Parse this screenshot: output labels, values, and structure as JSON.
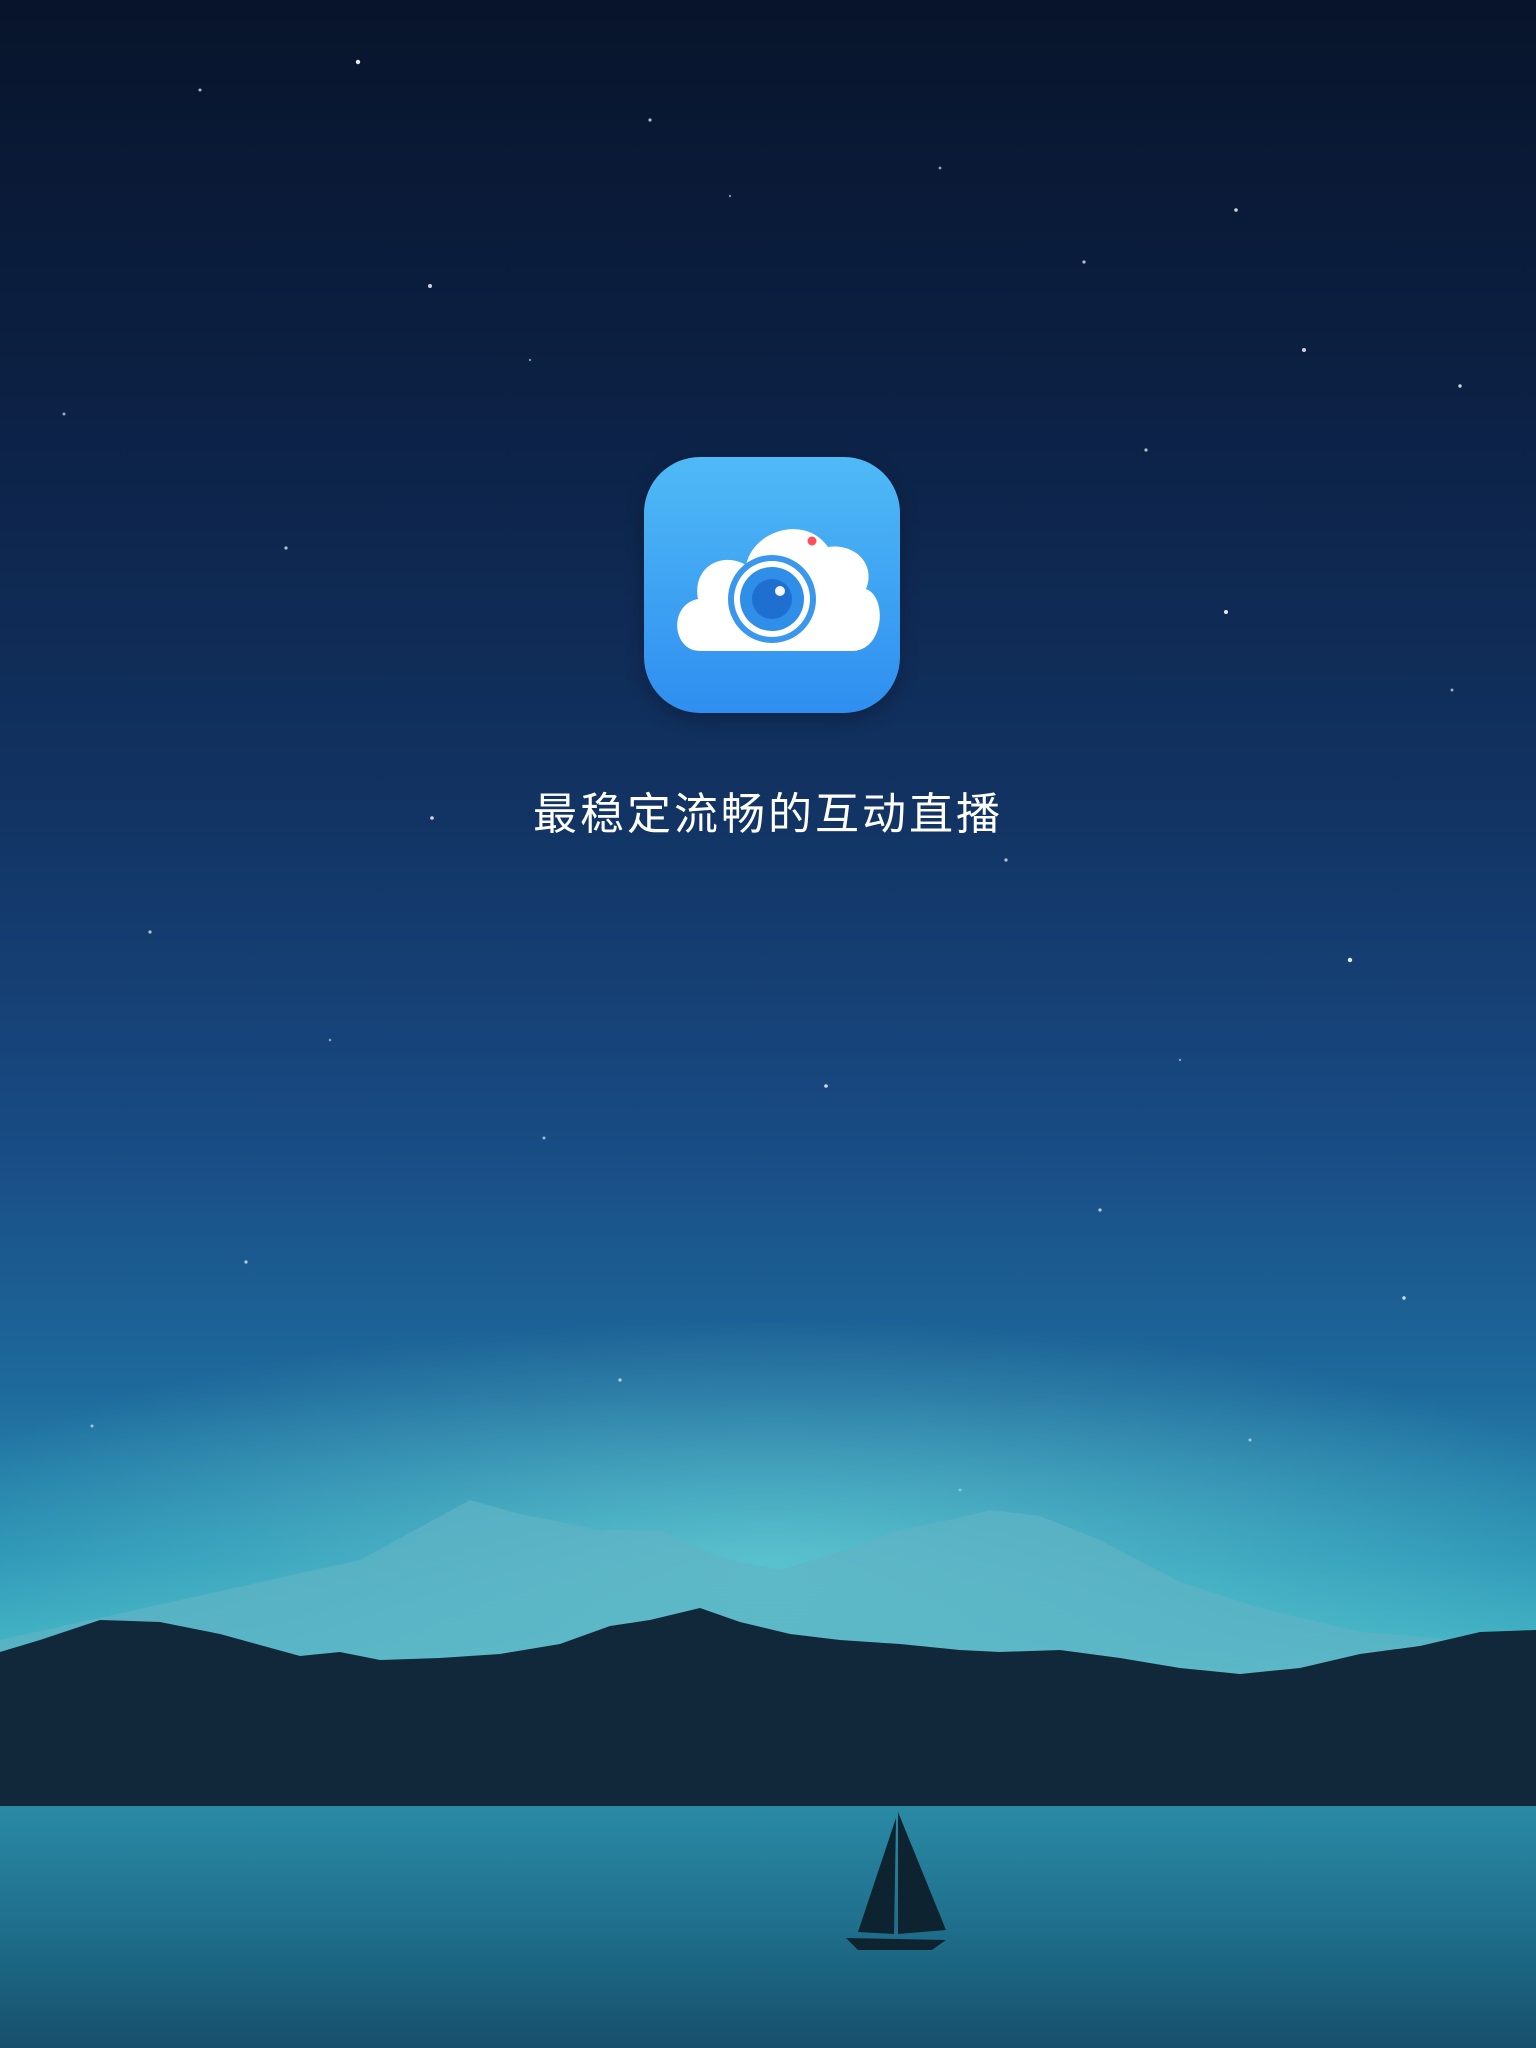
{
  "splash": {
    "tagline": "最稳定流畅的互动直播",
    "app_icon": "cloud-camera-icon",
    "background": "starry-night-lake-mountains",
    "colors": {
      "icon_top": "#4fbaf6",
      "icon_bottom": "#2f8ef0",
      "sky_top": "#08142b",
      "horizon_glow": "#63d0d2",
      "lens_blue": "#2e8ee8",
      "record_dot": "#ff4d5e"
    }
  }
}
